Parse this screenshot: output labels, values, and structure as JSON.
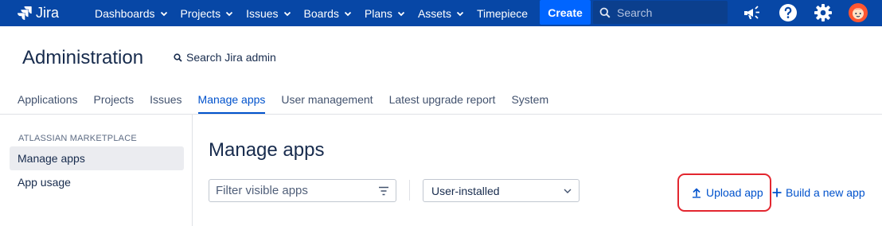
{
  "topnav": {
    "logo_text": "Jira",
    "items": [
      {
        "label": "Dashboards",
        "has_dropdown": true
      },
      {
        "label": "Projects",
        "has_dropdown": true
      },
      {
        "label": "Issues",
        "has_dropdown": true
      },
      {
        "label": "Boards",
        "has_dropdown": true
      },
      {
        "label": "Plans",
        "has_dropdown": true
      },
      {
        "label": "Assets",
        "has_dropdown": true
      },
      {
        "label": "Timepiece",
        "has_dropdown": false
      }
    ],
    "create_label": "Create",
    "search_placeholder": "Search",
    "icons": [
      "megaphone-icon",
      "help-icon",
      "gear-icon",
      "avatar"
    ],
    "colors": {
      "bar": "#0747a6",
      "create": "#0065ff"
    }
  },
  "admin": {
    "title": "Administration",
    "search_label": "Search Jira admin",
    "tabs": [
      {
        "label": "Applications",
        "active": false
      },
      {
        "label": "Projects",
        "active": false
      },
      {
        "label": "Issues",
        "active": false
      },
      {
        "label": "Manage apps",
        "active": true
      },
      {
        "label": "User management",
        "active": false
      },
      {
        "label": "Latest upgrade report",
        "active": false
      },
      {
        "label": "System",
        "active": false
      }
    ]
  },
  "sidebar": {
    "heading": "ATLASSIAN MARKETPLACE",
    "items": [
      {
        "label": "Manage apps",
        "selected": true
      },
      {
        "label": "App usage",
        "selected": false
      }
    ]
  },
  "main": {
    "title": "Manage apps",
    "filter_placeholder": "Filter visible apps",
    "select_value": "User-installed",
    "upload_label": "Upload app",
    "build_label": "Build a new app",
    "highlight_color": "#e3262f"
  }
}
